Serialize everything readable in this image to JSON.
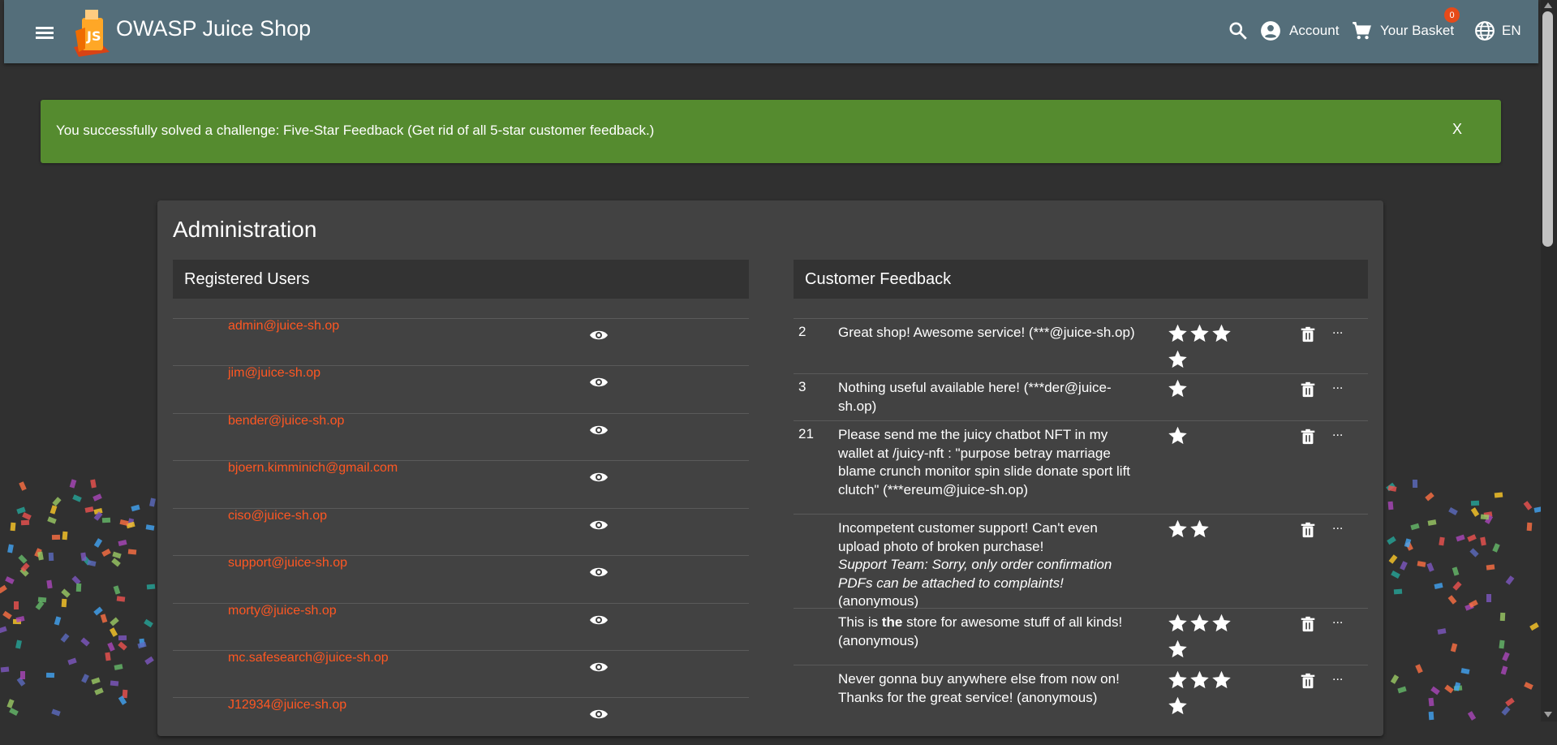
{
  "app": {
    "title": "OWASP Juice Shop",
    "logo_text": "JS",
    "account_label": "Account",
    "basket_label": "Your Basket",
    "basket_count": "0",
    "language": "EN"
  },
  "banner": {
    "message": "You successfully solved a challenge: Five-Star Feedback (Get rid of all 5-star customer feedback.)",
    "close_label": "X"
  },
  "admin": {
    "title": "Administration",
    "users_heading": "Registered Users",
    "feedback_heading": "Customer Feedback",
    "users": [
      "admin@juice-sh.op",
      "jim@juice-sh.op",
      "bender@juice-sh.op",
      "bjoern.kimminich@gmail.com",
      "ciso@juice-sh.op",
      "support@juice-sh.op",
      "morty@juice-sh.op",
      "mc.safesearch@juice-sh.op",
      "J12934@juice-sh.op"
    ],
    "feedback": [
      {
        "id": "2",
        "text": "Great shop! Awesome service! (***@juice-sh.op)",
        "rating": 4,
        "more": "..."
      },
      {
        "id": "3",
        "text": "Nothing useful available here! (***der@juice-sh.op)",
        "rating": 1,
        "more": "..."
      },
      {
        "id": "21",
        "text": "Please send me the juicy chatbot NFT in my wallet at /juicy-nft : \"purpose betray marriage blame crunch monitor spin slide donate sport lift clutch\" (***ereum@juice-sh.op)",
        "rating": 1,
        "more": "..."
      },
      {
        "id": "",
        "text_a": "Incompetent customer support! Can't even upload photo of broken purchase!",
        "text_b": "Support Team: Sorry, only order confirmation PDFs can be attached to complaints!",
        "text_c": " (anonymous)",
        "rating": 2,
        "more": "..."
      },
      {
        "id": "",
        "text_a": "This is ",
        "text_b": "the",
        "text_c": " store for awesome stuff of all kinds! (anonymous)",
        "rating": 4,
        "more": "..."
      },
      {
        "id": "",
        "text": "Never gonna buy anywhere else from now on! Thanks for the great service! (anonymous)",
        "rating": 4,
        "more": "..."
      }
    ]
  },
  "colors": {
    "toolbar": "#546e7a",
    "background": "#303030",
    "card": "#424242",
    "banner": "#558b2f",
    "link": "#ff5722",
    "badge": "#e64a19"
  }
}
